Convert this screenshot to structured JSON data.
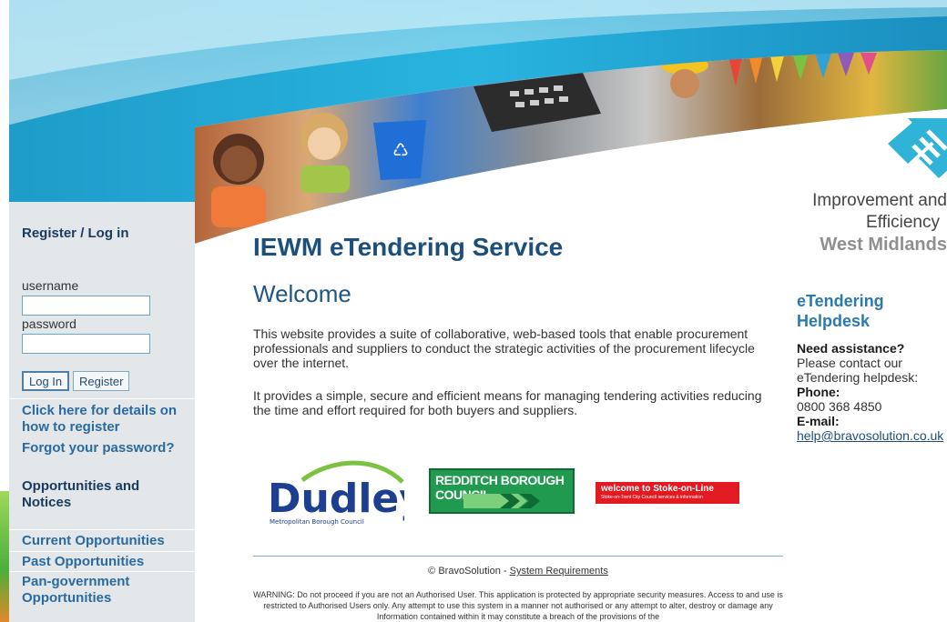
{
  "left_panel": {
    "register_heading": "Register / Log in",
    "username_label": "username",
    "password_label": "password",
    "login_button": "Log In",
    "register_button": "Register",
    "register_details_link": "Click here for details on how to register",
    "forgot_password_link": "Forgot your password?",
    "opportunities_heading": "Opportunities and Notices",
    "current_opportunities": "Current Opportunities",
    "past_opportunities": "Past Opportunities",
    "pan_government": "Pan-government Opportunities"
  },
  "main": {
    "title": "IEWM eTendering Service",
    "welcome": "Welcome",
    "para1": "This website provides a suite of collaborative, web-based tools that enable procurement professionals and suppliers to conduct the strategic activities of the procurement lifecycle over the internet.",
    "para2": "It provides a simple, secure and efficient means for managing tendering activities reducing the time and effort required for both buyers and suppliers."
  },
  "logos": {
    "dudley_name": "Dudley",
    "dudley_sub": "Metropolitan Borough Council",
    "redditch": "REDDITCH BOROUGH COUNCIL",
    "stoke_line1": "welcome to Stoke-on-Line",
    "stoke_line2": "Stoke-on-Trent City Council services & information"
  },
  "footer": {
    "copyright": "© BravoSolution - ",
    "system_requirements": "System Requirements",
    "warning": "WARNING: Do not proceed if you are not an Authorised User. This application is protected by appropriate security measures. Access to and use is restricted to Authorised Users only. Any attempt to use this system in a manner not authorised or any attempt to alter, destroy or damage any Information contained within it may constitute a breach of the provisions of the"
  },
  "ie_logo": {
    "line1": "Improvement and",
    "line2": "Efficiency",
    "line3": "West Midlands"
  },
  "helpdesk": {
    "title_line1": "eTendering",
    "title_line2": "Helpdesk",
    "need_assistance": "Need assistance?",
    "contact_line1": "Please contact our",
    "contact_line2": "eTendering helpdesk:",
    "phone_label": "Phone:",
    "phone": "0800 368 4850",
    "email_label": "E-mail:",
    "email": "help@bravosolution.co.uk"
  },
  "colors": {
    "brand_blue": "#1c4f7c",
    "banner_teal": "#25a9d6",
    "link_blue": "#2a6a9e"
  }
}
